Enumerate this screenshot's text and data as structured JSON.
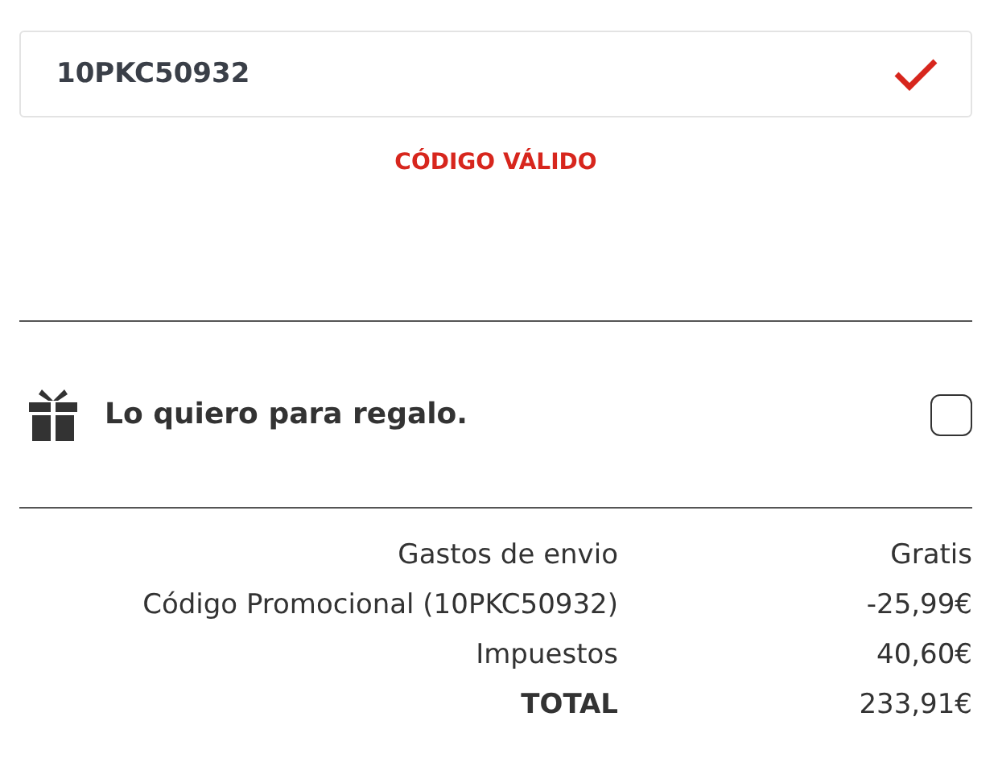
{
  "promo_code": {
    "value": "10PKC50932",
    "valid": true,
    "message": "CÓDIGO VÁLIDO"
  },
  "gift_option": {
    "label": "Lo quiero para regalo.",
    "checked": false
  },
  "summary": [
    {
      "kind": "line",
      "label": "Gastos de envio",
      "value": "Gratis"
    },
    {
      "kind": "line",
      "label": "Código Promocional (10PKC50932)",
      "value": "-25,99€"
    },
    {
      "kind": "line",
      "label": "Impuestos",
      "value": "40,60€"
    },
    {
      "kind": "total",
      "label": "TOTAL",
      "value": "233,91€"
    }
  ]
}
